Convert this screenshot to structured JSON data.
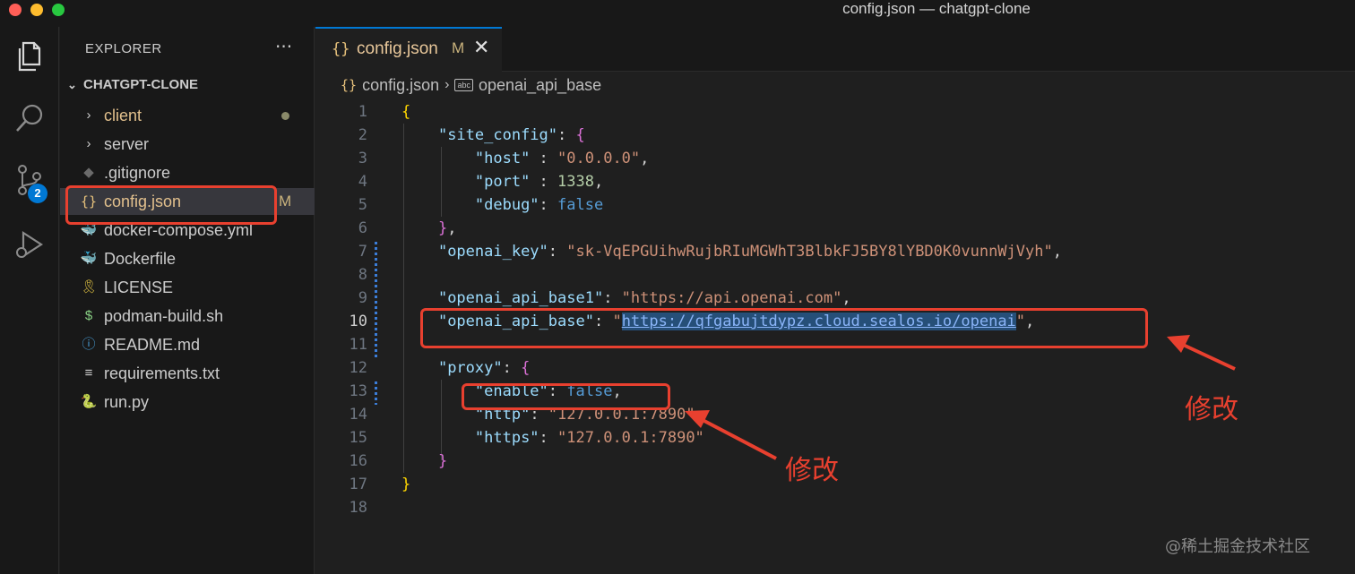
{
  "window": {
    "title": "config.json — chatgpt-clone"
  },
  "activity_bar": {
    "scm_badge": "2"
  },
  "sidebar": {
    "title": "EXPLORER",
    "more": "···",
    "folder": "CHATGPT-CLONE",
    "items": [
      {
        "icon": "›",
        "name": "client",
        "status": "dot"
      },
      {
        "icon": "›",
        "name": "server"
      },
      {
        "icon": "◆",
        "name": ".gitignore"
      },
      {
        "icon": "{}",
        "name": "config.json",
        "modified": "M"
      },
      {
        "icon": "🐳",
        "name": "docker-compose.yml"
      },
      {
        "icon": "🐳",
        "name": "Dockerfile"
      },
      {
        "icon": "🎗",
        "name": "LICENSE"
      },
      {
        "icon": "$",
        "name": "podman-build.sh"
      },
      {
        "icon": "ⓘ",
        "name": "README.md"
      },
      {
        "icon": "≡",
        "name": "requirements.txt"
      },
      {
        "icon": "🐍",
        "name": "run.py"
      }
    ]
  },
  "tab": {
    "icon": "{}",
    "name": "config.json",
    "modified": "M",
    "close": "✕"
  },
  "breadcrumb": {
    "icon": "{}",
    "file": "config.json",
    "sep": "›",
    "sym_icon": "abc",
    "symbol": "openai_api_base"
  },
  "code": {
    "line_numbers": [
      "1",
      "2",
      "3",
      "4",
      "5",
      "6",
      "7",
      "8",
      "9",
      "10",
      "11",
      "12",
      "13",
      "14",
      "15",
      "16",
      "17",
      "18"
    ],
    "l1_open": "{",
    "l2_key": "\"site_config\"",
    "l2_colon": ": ",
    "l2_open": "{",
    "l3_key": "\"host\"",
    "l3_colon": " : ",
    "l3_val": "\"0.0.0.0\"",
    "l3_comma": ",",
    "l4_key": "\"port\"",
    "l4_colon": " : ",
    "l4_val": "1338",
    "l4_comma": ",",
    "l5_key": "\"debug\"",
    "l5_colon": ": ",
    "l5_val": "false",
    "l6_close": "}",
    "l6_comma": ",",
    "l7_key": "\"openai_key\"",
    "l7_colon": ": ",
    "l7_val": "\"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\"",
    "l7_comma": ",",
    "l9_key": "\"openai_api_base1\"",
    "l9_colon": ": ",
    "l9_val": "\"https://api.openai.com\"",
    "l9_comma": ",",
    "l10_key": "\"openai_api_base\"",
    "l10_colon": ": ",
    "l10_q1": "\"",
    "l10_url": "https://qfgabujtdypz.cloud.sealos.io/openai",
    "l10_q2": "\"",
    "l10_comma": ",",
    "l12_key": "\"proxy\"",
    "l12_colon": ": ",
    "l12_open": "{",
    "l13_key": "\"enable\"",
    "l13_colon": ": ",
    "l13_val": "false",
    "l13_comma": ",",
    "l14_key": "\"http\"",
    "l14_colon": ": ",
    "l14_val": "\"127.0.0.1:7890\"",
    "l14_comma": ",",
    "l15_key": "\"https\"",
    "l15_colon": ": ",
    "l15_val": "\"127.0.0.1:7890\"",
    "l16_close": "}",
    "l17_close": "}"
  },
  "annotations": {
    "label_1": "修改",
    "label_2": "修改"
  },
  "watermark": "@稀土掘金技术社区",
  "colors": {
    "accent": "#0078d4",
    "annotation": "#e8402f"
  }
}
